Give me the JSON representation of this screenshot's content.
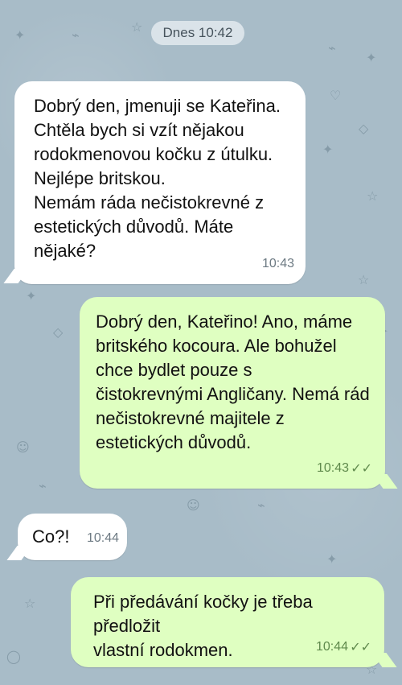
{
  "chat": {
    "date_label": "Dnes 10:42",
    "messages": [
      {
        "direction": "incoming",
        "text": "Dobrý den, jmenuji se Kateřina.\nChtěla bych si vzít nějakou\nrodokmenovou kočku z útulku.\nNejlépe britskou.\nNemám ráda nečistokrevné z\nestetických důvodů. Máte\nnějaké?",
        "time": "10:43"
      },
      {
        "direction": "outgoing",
        "text": "Dobrý den, Kateřino! Ano, máme\nbritského kocoura. Ale bohužel\nchce bydlet pouze s\nčistokrevnými Angličany. Nemá rád\nnečistokrevné majitele z\nestetických důvodů.",
        "time": "10:43",
        "status": "read"
      },
      {
        "direction": "incoming",
        "text": "Co?!",
        "time": "10:44"
      },
      {
        "direction": "outgoing",
        "text": "Při předávání kočky je třeba předložit\nvlastní rodokmen.",
        "time": "10:44",
        "status": "read"
      }
    ]
  },
  "icons": {
    "read_receipt": "double-check-icon",
    "background_pattern": "cat-paw-fish-bone-doodles"
  },
  "colors": {
    "background": "#a8bcc8",
    "incoming_bubble": "#ffffff",
    "outgoing_bubble": "#dfffc1",
    "outgoing_meta": "#5f8a4c"
  }
}
